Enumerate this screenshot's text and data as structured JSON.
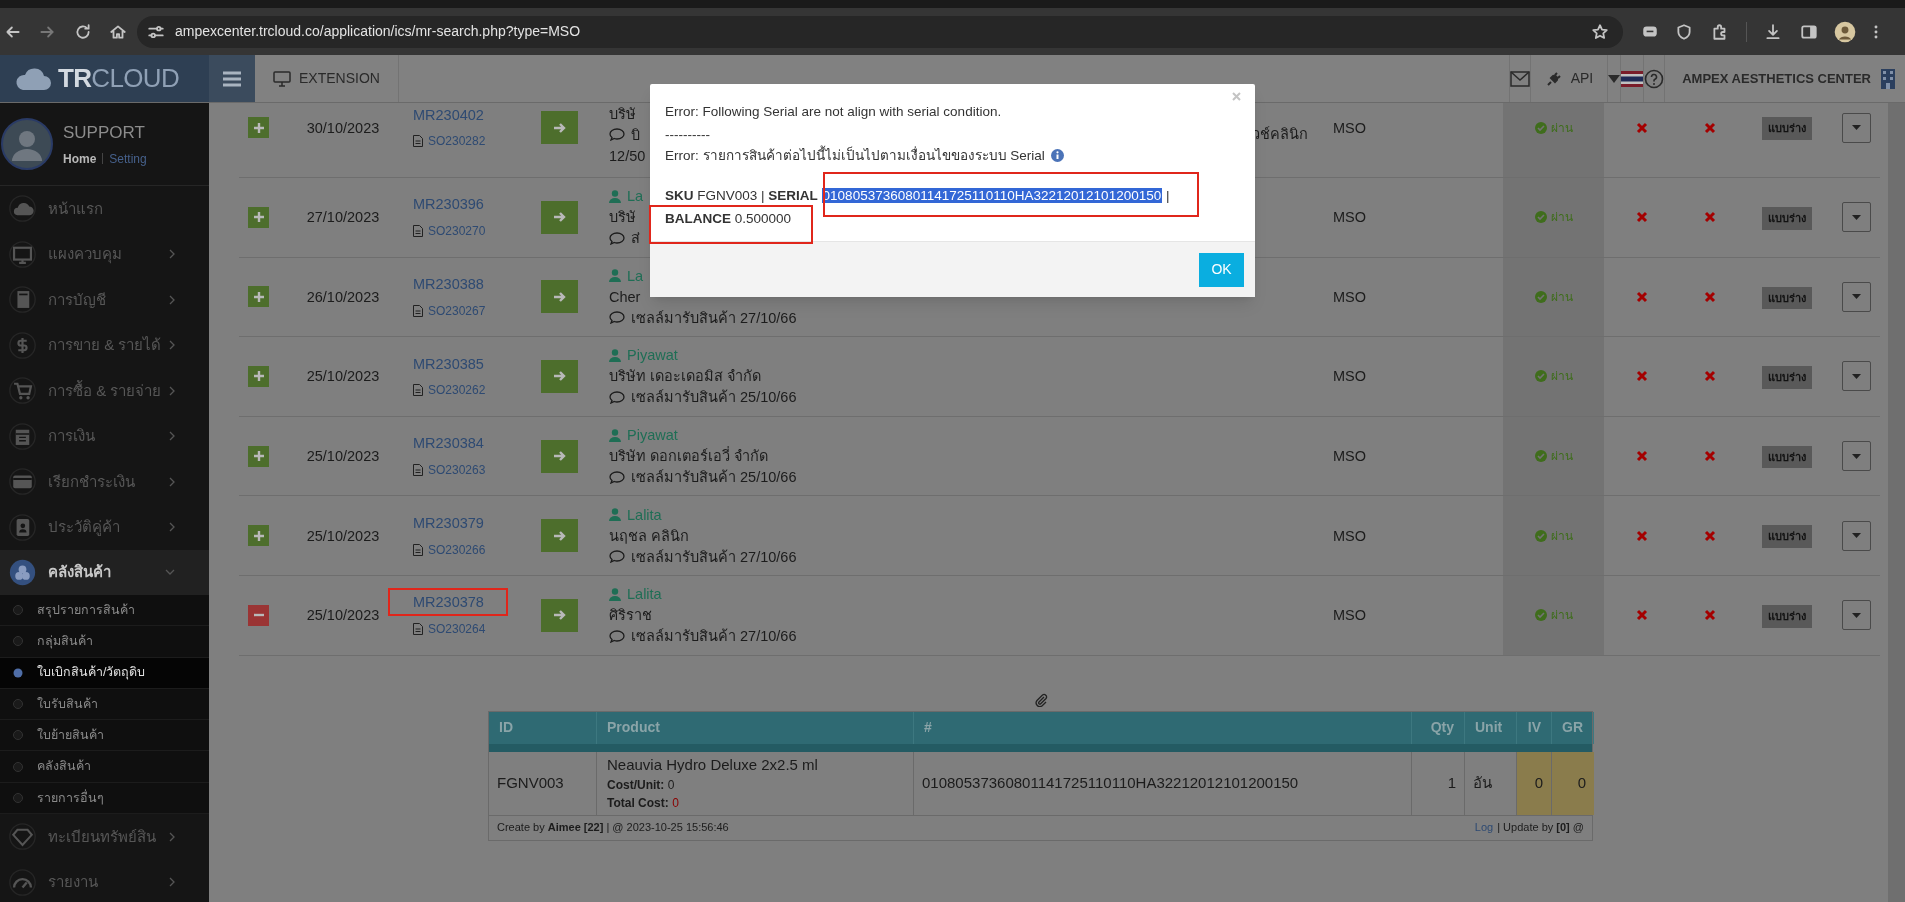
{
  "browser": {
    "url": "ampexcenter.trcloud.co/application/ics/mr-search.php?type=MSO"
  },
  "header": {
    "logo": "**TR**CLOUD",
    "extension": "EXTENSION",
    "api": "API",
    "company": "AMPEX AESTHETICS CENTER"
  },
  "profile": {
    "name": "SUPPORT",
    "home": "Home",
    "setting": "Setting"
  },
  "sidebar": {
    "items": [
      {
        "label": "หน้าแรก",
        "kind": "link"
      },
      {
        "label": "แผงควบคุม",
        "kind": "group",
        "expanded": false
      },
      {
        "label": "การบัญชี",
        "kind": "group",
        "expanded": false
      },
      {
        "label": "การขาย & รายได้",
        "kind": "group",
        "expanded": false
      },
      {
        "label": "การซื้อ & รายจ่าย",
        "kind": "group",
        "expanded": false
      },
      {
        "label": "การเงิน",
        "kind": "group",
        "expanded": false
      },
      {
        "label": "เรียกชำระเงิน",
        "kind": "group",
        "expanded": false
      },
      {
        "label": "ประวัติคู่ค้า",
        "kind": "group",
        "expanded": false
      },
      {
        "label": "คลังสินค้า",
        "kind": "group",
        "expanded": true,
        "children": [
          {
            "label": "สรุปรายการสินค้า",
            "selected": false
          },
          {
            "label": "กลุ่มสินค้า",
            "selected": false
          },
          {
            "label": "ใบเบิกสินค้า/วัตถุดิบ",
            "selected": true
          },
          {
            "label": "ใบรับสินค้า",
            "selected": false
          },
          {
            "label": "ใบย้ายสินค้า",
            "selected": false
          },
          {
            "label": "คลังสินค้า",
            "selected": false
          },
          {
            "label": "รายการอื่นๆ",
            "selected": false
          }
        ]
      },
      {
        "label": "ทะเบียนทรัพย์สิน",
        "kind": "group",
        "expanded": false
      },
      {
        "label": "รายงาน",
        "kind": "group",
        "expanded": false
      }
    ]
  },
  "rows": [
    {
      "expanded": false,
      "date": "30/10/2023",
      "mr": "MR230402",
      "so": "SO230282",
      "customer": "บริษั",
      "note": "บิ",
      "note_tail": "วช์คลินิก",
      "note_more": "12/50",
      "type": "MSO",
      "status": "ผ่าน",
      "badge": "แบบร่าง"
    },
    {
      "expanded": false,
      "date": "27/10/2023",
      "mr": "MR230396",
      "so": "SO230270",
      "user": "La",
      "customer": "บริษั",
      "note": "ส่",
      "type": "MSO",
      "status": "ผ่าน",
      "badge": "แบบร่าง"
    },
    {
      "expanded": false,
      "date": "26/10/2023",
      "mr": "MR230388",
      "so": "SO230267",
      "user": "La",
      "customer": "Cher",
      "note": "เซลล์มารับสินค้า 27/10/66",
      "type": "MSO",
      "status": "ผ่าน",
      "badge": "แบบร่าง"
    },
    {
      "expanded": false,
      "date": "25/10/2023",
      "mr": "MR230385",
      "so": "SO230262",
      "user": "Piyawat",
      "customer": "บริษัท เดอะเดอมิส จำกัด",
      "note": "เซลล์มารับสินค้า 25/10/66",
      "type": "MSO",
      "status": "ผ่าน",
      "badge": "แบบร่าง"
    },
    {
      "expanded": false,
      "date": "25/10/2023",
      "mr": "MR230384",
      "so": "SO230263",
      "user": "Piyawat",
      "customer": "บริษัท ดอกเตอร์เอวี่ จำกัด",
      "note": "เซลล์มารับสินค้า 25/10/66",
      "type": "MSO",
      "status": "ผ่าน",
      "badge": "แบบร่าง"
    },
    {
      "expanded": false,
      "date": "25/10/2023",
      "mr": "MR230379",
      "so": "SO230266",
      "user": "Lalita",
      "customer": "นฤชล คลินิก",
      "note": "เซลล์มารับสินค้า 27/10/66",
      "type": "MSO",
      "status": "ผ่าน",
      "badge": "แบบร่าง"
    },
    {
      "expanded": true,
      "date": "25/10/2023",
      "mr": "MR230378",
      "so": "SO230264",
      "user": "Lalita",
      "customer": "ศิริราช",
      "note": "เซลล์มารับสินค้า 27/10/66",
      "type": "MSO",
      "status": "ผ่าน",
      "badge": "แบบร่าง"
    }
  ],
  "detail": {
    "columns": [
      "ID",
      "Product",
      "#",
      "Qty",
      "Unit",
      "IV",
      "GR"
    ],
    "row": {
      "id": "FGNV003",
      "product": "Neauvia Hydro Deluxe 2x2.5 ml",
      "cost_unit_label": "Cost/Unit:",
      "cost_unit": "0",
      "total_cost_label": "Total Cost:",
      "total_cost": "0",
      "serial": "01080537360801141725110110HA32212012101200150",
      "qty": "1",
      "unit": "อัน",
      "iv": "0",
      "gr": "0"
    },
    "footer": {
      "created": "Create by **Aimee [22]** | @ 2023-10-25 15:56:46",
      "log": "Log",
      "updated": "| Update by **[0]** @"
    }
  },
  "modal": {
    "line1": "Error: Following Serial are not align with serial condition.",
    "divider": "----------",
    "line2": "Error: รายการสินค้าต่อไปนี้ไม่เป็นไปตามเงื่อนไขของระบบ Serial",
    "sku": "**SKU** FGNV003 | **SERIAL**",
    "serial": "01080537360801141725110110HA32212012101200150",
    "sku_end": "|",
    "balance": "**BALANCE** 0.500000",
    "ok": "OK"
  }
}
